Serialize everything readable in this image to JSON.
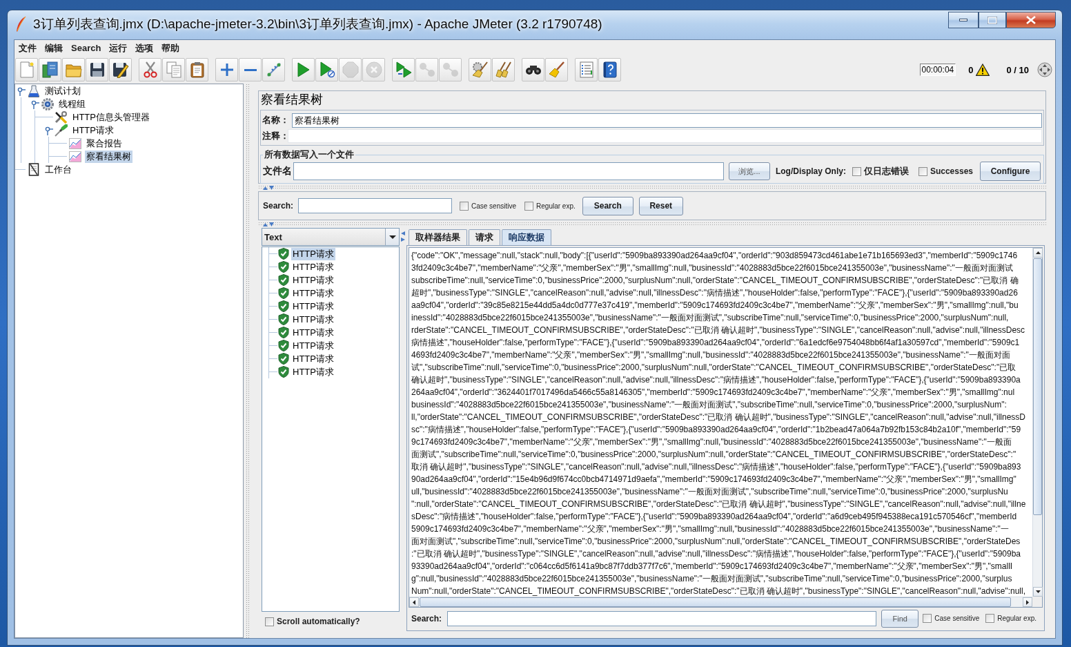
{
  "window": {
    "title": "3订单列表查询.jmx (D:\\apache-jmeter-3.2\\bin\\3订单列表查询.jmx) - Apache JMeter (3.2 r1790748)"
  },
  "menu": [
    "文件",
    "编辑",
    "Search",
    "运行",
    "选项",
    "帮助"
  ],
  "toolbar": [
    [
      {
        "kind": "new",
        "disabled": false
      },
      {
        "kind": "templates",
        "disabled": false
      },
      {
        "kind": "open",
        "disabled": false
      },
      {
        "kind": "save",
        "disabled": false
      },
      {
        "kind": "saveas",
        "disabled": false
      }
    ],
    [
      {
        "kind": "cut",
        "disabled": false
      },
      {
        "kind": "copy",
        "disabled": false
      },
      {
        "kind": "paste",
        "disabled": false
      }
    ],
    [
      {
        "kind": "expand",
        "disabled": false
      },
      {
        "kind": "collapse",
        "disabled": false
      },
      {
        "kind": "toggle",
        "disabled": false
      }
    ],
    [
      {
        "kind": "start",
        "disabled": false
      },
      {
        "kind": "startnopause",
        "disabled": false
      },
      {
        "kind": "stop",
        "disabled": true
      },
      {
        "kind": "shutdown",
        "disabled": true
      }
    ],
    [
      {
        "kind": "remotestart",
        "disabled": false
      },
      {
        "kind": "remotestop",
        "disabled": true
      },
      {
        "kind": "remoteexit",
        "disabled": true
      }
    ],
    [
      {
        "kind": "clear",
        "disabled": false
      },
      {
        "kind": "clearall",
        "disabled": false
      }
    ],
    [
      {
        "kind": "search",
        "disabled": false
      },
      {
        "kind": "resetsearch",
        "disabled": false
      }
    ],
    [
      {
        "kind": "functions",
        "disabled": false
      },
      {
        "kind": "help",
        "disabled": false
      }
    ]
  ],
  "status": {
    "elapsed": "00:00:04",
    "errors": "0",
    "threads": "0 / 10"
  },
  "tree": [
    {
      "label": "测试计划",
      "kind": "plan",
      "expanded": true,
      "selected": false,
      "children": [
        {
          "label": "线程组",
          "kind": "threads",
          "expanded": true,
          "selected": false,
          "children": [
            {
              "label": "HTTP信息头管理器",
              "kind": "config",
              "selected": false
            },
            {
              "label": "HTTP请求",
              "kind": "sampler",
              "expanded": true,
              "selected": false,
              "children": [
                {
                  "label": "聚合报告",
                  "kind": "listener",
                  "selected": false
                },
                {
                  "label": "察看结果树",
                  "kind": "listener",
                  "selected": true
                }
              ]
            }
          ]
        }
      ]
    },
    {
      "label": "工作台",
      "kind": "workbench",
      "selected": false
    }
  ],
  "panel": {
    "title": "察看结果树",
    "name": {
      "label": "名称：",
      "value": "察看结果树"
    },
    "comment": {
      "label": "注释："
    },
    "file": {
      "title": "所有数据写入一个文件",
      "label": "文件名",
      "browse": "浏览...",
      "log_label": "Log/Display Only:",
      "options": [
        {
          "label": "仅日志错误",
          "checked": false
        },
        {
          "label": "Successes",
          "checked": false
        }
      ],
      "configure": "Configure"
    }
  },
  "search": {
    "label": "Search:",
    "options": [
      {
        "label": "Case sensitive",
        "checked": false
      },
      {
        "label": "Regular exp.",
        "checked": false
      }
    ],
    "buttons": [
      "Search",
      "Reset"
    ]
  },
  "results": {
    "renderer": "Text",
    "items": [
      {
        "label": "HTTP请求",
        "passed": true,
        "selected": true
      },
      {
        "label": "HTTP请求",
        "passed": true,
        "selected": false
      },
      {
        "label": "HTTP请求",
        "passed": true,
        "selected": false
      },
      {
        "label": "HTTP请求",
        "passed": true,
        "selected": false
      },
      {
        "label": "HTTP请求",
        "passed": true,
        "selected": false
      },
      {
        "label": "HTTP请求",
        "passed": true,
        "selected": false
      },
      {
        "label": "HTTP请求",
        "passed": true,
        "selected": false
      },
      {
        "label": "HTTP请求",
        "passed": true,
        "selected": false
      },
      {
        "label": "HTTP请求",
        "passed": true,
        "selected": false
      },
      {
        "label": "HTTP请求",
        "passed": true,
        "selected": false
      }
    ],
    "autoscroll": {
      "label": "Scroll automatically?",
      "checked": false
    }
  },
  "tabs": [
    {
      "label": "取样器结果",
      "selected": false
    },
    {
      "label": "请求",
      "selected": false
    },
    {
      "label": "响应数据",
      "selected": true
    }
  ],
  "response": {
    "lines": [
      "{\"code\":\"OK\",\"message\":null,\"stack\":null,\"body\":[{\"userId\":\"5909ba893390ad264aa9cf04\",\"orderId\":\"903d859473cd461abe1e71b165693ed3\",\"memberId\":\"5909c1746",
      "3fd2409c3c4be7\",\"memberName\":\"父亲\",\"memberSex\":\"男\",\"smallImg\":null,\"businessId\":\"4028883d5bce22f6015bce241355003e\",\"businessName\":\"一般面对面测试",
      "subscribeTime\":null,\"serviceTime\":0,\"businessPrice\":2000,\"surplusNum\":null,\"orderState\":\"CANCEL_TIMEOUT_CONFIRMSUBSCRIBE\",\"orderStateDesc\":\"已取消 确",
      "超时\",\"businessType\":\"SINGLE\",\"cancelReason\":null,\"advise\":null,\"illnessDesc\":\"病情描述\",\"houseHolder\":false,\"performType\":\"FACE\"},{\"userId\":\"5909ba893390ad26",
      "aa9cf04\",\"orderId\":\"39c85e8215e44dd5a4dc0d777e37c419\",\"memberId\":\"5909c174693fd2409c3c4be7\",\"memberName\":\"父亲\",\"memberSex\":\"男\",\"smallImg\":null,\"bu",
      "inessId\":\"4028883d5bce22f6015bce241355003e\",\"businessName\":\"一般面对面测试\",\"subscribeTime\":null,\"serviceTime\":0,\"businessPrice\":2000,\"surplusNum\":null,",
      "rderState\":\"CANCEL_TIMEOUT_CONFIRMSUBSCRIBE\",\"orderStateDesc\":\"已取消 确认超时\",\"businessType\":\"SINGLE\",\"cancelReason\":null,\"advise\":null,\"illnessDesc",
      "病情描述\",\"houseHolder\":false,\"performType\":\"FACE\"},{\"userId\":\"5909ba893390ad264aa9cf04\",\"orderId\":\"6a1edcf6e9754048bb6f4af1a30597cd\",\"memberId\":\"5909c1",
      "4693fd2409c3c4be7\",\"memberName\":\"父亲\",\"memberSex\":\"男\",\"smallImg\":null,\"businessId\":\"4028883d5bce22f6015bce241355003e\",\"businessName\":\"一般面对面",
      "试\",\"subscribeTime\":null,\"serviceTime\":0,\"businessPrice\":2000,\"surplusNum\":null,\"orderState\":\"CANCEL_TIMEOUT_CONFIRMSUBSCRIBE\",\"orderStateDesc\":\"已取",
      "确认超时\",\"businessType\":\"SINGLE\",\"cancelReason\":null,\"advise\":null,\"illnessDesc\":\"病情描述\",\"houseHolder\":false,\"performType\":\"FACE\"},{\"userId\":\"5909ba893390a",
      "264aa9cf04\",\"orderId\":\"3624401f7017496da5466c55a8146305\",\"memberId\":\"5909c174693fd2409c3c4be7\",\"memberName\":\"父亲\",\"memberSex\":\"男\",\"smallImg\":nul",
      "businessId\":\"4028883d5bce22f6015bce241355003e\",\"businessName\":\"一般面对面测试\",\"subscribeTime\":null,\"serviceTime\":0,\"businessPrice\":2000,\"surplusNum\":",
      "ll,\"orderState\":\"CANCEL_TIMEOUT_CONFIRMSUBSCRIBE\",\"orderStateDesc\":\"已取消 确认超时\",\"businessType\":\"SINGLE\",\"cancelReason\":null,\"advise\":null,\"illnessD",
      "sc\":\"病情描述\",\"houseHolder\":false,\"performType\":\"FACE\"},{\"userId\":\"5909ba893390ad264aa9cf04\",\"orderId\":\"1b2bead47a064a7b92fb153c84b2a10f\",\"memberId\":\"59",
      "9c174693fd2409c3c4be7\",\"memberName\":\"父亲\",\"memberSex\":\"男\",\"smallImg\":null,\"businessId\":\"4028883d5bce22f6015bce241355003e\",\"businessName\":\"一般面",
      "面测试\",\"subscribeTime\":null,\"serviceTime\":0,\"businessPrice\":2000,\"surplusNum\":null,\"orderState\":\"CANCEL_TIMEOUT_CONFIRMSUBSCRIBE\",\"orderStateDesc\":\"",
      "取消 确认超时\",\"businessType\":\"SINGLE\",\"cancelReason\":null,\"advise\":null,\"illnessDesc\":\"病情描述\",\"houseHolder\":false,\"performType\":\"FACE\"},{\"userId\":\"5909ba893",
      "90ad264aa9cf04\",\"orderId\":\"15e4b96d9f674cc0bcb4714971d9aefa\",\"memberId\":\"5909c174693fd2409c3c4be7\",\"memberName\":\"父亲\",\"memberSex\":\"男\",\"smallImg\"",
      "ull,\"businessId\":\"4028883d5bce22f6015bce241355003e\",\"businessName\":\"一般面对面测试\",\"subscribeTime\":null,\"serviceTime\":0,\"businessPrice\":2000,\"surplusNu",
      "\":null,\"orderState\":\"CANCEL_TIMEOUT_CONFIRMSUBSCRIBE\",\"orderStateDesc\":\"已取消 确认超时\",\"businessType\":\"SINGLE\",\"cancelReason\":null,\"advise\":null,\"illne",
      "sDesc\":\"病情描述\",\"houseHolder\":false,\"performType\":\"FACE\"},{\"userId\":\"5909ba893390ad264aa9cf04\",\"orderId\":\"a6d9ceb495f945388eca191c570546cf\",\"memberId",
      "5909c174693fd2409c3c4be7\",\"memberName\":\"父亲\",\"memberSex\":\"男\",\"smallImg\":null,\"businessId\":\"4028883d5bce22f6015bce241355003e\",\"businessName\":\"一",
      "面对面测试\",\"subscribeTime\":null,\"serviceTime\":0,\"businessPrice\":2000,\"surplusNum\":null,\"orderState\":\"CANCEL_TIMEOUT_CONFIRMSUBSCRIBE\",\"orderStateDes",
      ":\"已取消 确认超时\",\"businessType\":\"SINGLE\",\"cancelReason\":null,\"advise\":null,\"illnessDesc\":\"病情描述\",\"houseHolder\":false,\"performType\":\"FACE\"},{\"userId\":\"5909ba",
      "93390ad264aa9cf04\",\"orderId\":\"c064cc6d5f6141a9bc87f7ddb377f7c6\",\"memberId\":\"5909c174693fd2409c3c4be7\",\"memberName\":\"父亲\",\"memberSex\":\"男\",\"smallI",
      "g\":null,\"businessId\":\"4028883d5bce22f6015bce241355003e\",\"businessName\":\"一般面对面测试\",\"subscribeTime\":null,\"serviceTime\":0,\"businessPrice\":2000,\"surplus",
      "Num\":null,\"orderState\":\"CANCEL_TIMEOUT_CONFIRMSUBSCRIBE\",\"orderStateDesc\":\"已取消 确认超时\",\"businessType\":\"SINGLE\",\"cancelReason\":null,\"advise\":null,"
    ],
    "find": {
      "label": "Search:",
      "button": "Find",
      "options": [
        {
          "label": "Case sensitive",
          "checked": false
        },
        {
          "label": "Regular exp.",
          "checked": false
        }
      ]
    }
  }
}
